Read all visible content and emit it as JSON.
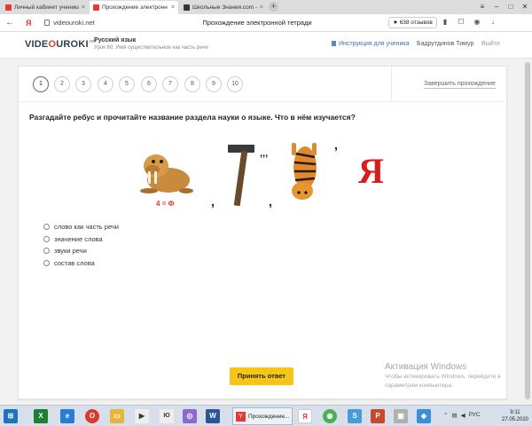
{
  "browser": {
    "tabs": [
      {
        "label": "Личный кабинет ученика",
        "color": "#e53935"
      },
      {
        "label": "Прохождение электронн",
        "color": "#e53935"
      },
      {
        "label": "Школьные Знания.com -",
        "color": "#333333"
      }
    ],
    "new_tab": "+",
    "url": "videouroki.net",
    "page_title": "Прохождение электронной тетради",
    "reviews": "★ 638 отзывов"
  },
  "site": {
    "logo_a": "VIDE",
    "logo_o": "O",
    "logo_b": "UROKI",
    "logo_suffix": ".net",
    "course_title": "Русский язык",
    "lesson": "Урок 60. Имя существительное как часть речи",
    "instruction": "Инструкция для ученика",
    "user": "Бадрутдинов Тимур",
    "logout": "Выйти"
  },
  "steps": [
    "1",
    "2",
    "3",
    "4",
    "5",
    "6",
    "7",
    "8",
    "9",
    "10"
  ],
  "active_step": "1",
  "finish": "Завершить прохождение",
  "question": "Разгадайте ребус и прочитайте название раздела науки о языке. Что в нём изучается?",
  "rebus": {
    "caption": "4 = Ф",
    "comma1": ",",
    "comma2": ",",
    "commas3": ",,,",
    "comma4": ",",
    "letter": "Я"
  },
  "options": [
    "слово как часть речи",
    "значение слова",
    "звуки речи",
    "состав слова"
  ],
  "submit": "Принять ответ",
  "watermark": {
    "title": "Активация Windows",
    "line1": "Чтобы активировать Windows, перейдите в",
    "line2": "параметрам компьютера."
  },
  "taskbar": {
    "active_label": "Прохождение...",
    "lang": "РУС",
    "time": "9:11",
    "date": "27.05.2020"
  }
}
